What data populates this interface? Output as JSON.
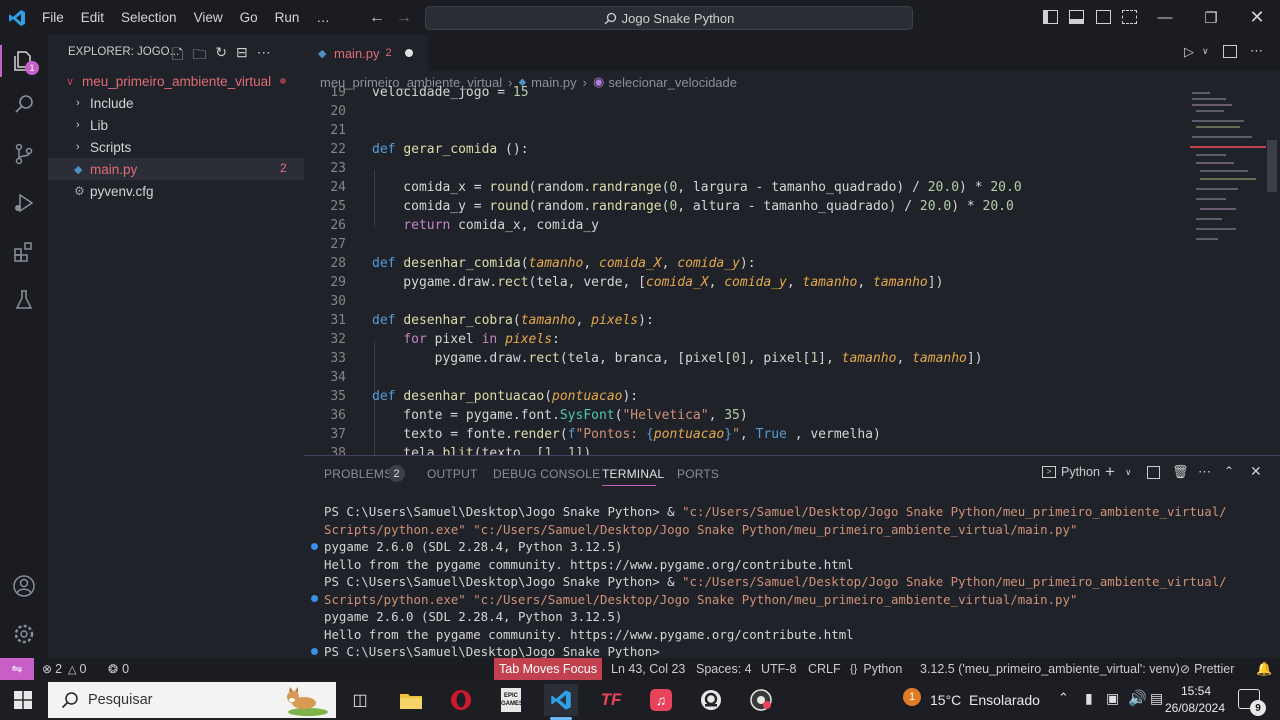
{
  "menu": [
    "File",
    "Edit",
    "Selection",
    "View",
    "Go",
    "Run",
    "…"
  ],
  "search": {
    "text": "Jogo Snake Python"
  },
  "activity": {
    "explorer_badge": "1"
  },
  "explorer": {
    "title": "EXPLORER: JOGO...",
    "root": "meu_primeiro_ambiente_virtual",
    "items": [
      {
        "label": "Include"
      },
      {
        "label": "Lib"
      },
      {
        "label": "Scripts"
      },
      {
        "label": "main.py",
        "badge": "2"
      },
      {
        "label": "pyvenv.cfg"
      }
    ]
  },
  "tab": {
    "label": "main.py",
    "badge": "2"
  },
  "breadcrumb": [
    "meu_primeiro_ambiente_virtual",
    "main.py",
    "selecionar_velocidade"
  ],
  "code_line_numbers": [
    "19",
    "20",
    "21",
    "22",
    "23",
    "24",
    "25",
    "26",
    "27",
    "28",
    "29",
    "30",
    "31",
    "32",
    "33",
    "34",
    "35",
    "36",
    "37",
    "38"
  ],
  "panel": {
    "tabs": [
      "PROBLEMS",
      "OUTPUT",
      "DEBUG CONSOLE",
      "TERMINAL",
      "PORTS"
    ],
    "problems_badge": "2",
    "terminal_type": "Python",
    "lines": [
      {
        "prefix": "PS C:\\Users\\Samuel\\Desktop\\Jogo Snake Python> & ",
        "path": "\"c:/Users/Samuel/Desktop/Jogo Snake Python/meu_primeiro_ambiente_virtual/",
        "dot": false
      },
      {
        "prefix": "",
        "path": "Scripts/python.exe\" \"c:/Users/Samuel/Desktop/Jogo Snake Python/meu_primeiro_ambiente_virtual/main.py\"",
        "dot": false
      },
      {
        "prefix": "pygame 2.6.0 (SDL 2.28.4, Python 3.12.5)",
        "path": "",
        "dot": true
      },
      {
        "prefix": "Hello from the pygame community. https://www.pygame.org/contribute.html",
        "path": "",
        "dot": false
      },
      {
        "prefix": "PS C:\\Users\\Samuel\\Desktop\\Jogo Snake Python> & ",
        "path": "\"c:/Users/Samuel/Desktop/Jogo Snake Python/meu_primeiro_ambiente_virtual/",
        "dot": false
      },
      {
        "prefix": "",
        "path": "Scripts/python.exe\" \"c:/Users/Samuel/Desktop/Jogo Snake Python/meu_primeiro_ambiente_virtual/main.py\"",
        "dot": true
      },
      {
        "prefix": "pygame 2.6.0 (SDL 2.28.4, Python 3.12.5)",
        "path": "",
        "dot": false
      },
      {
        "prefix": "Hello from the pygame community. https://www.pygame.org/contribute.html",
        "path": "",
        "dot": false
      },
      {
        "prefix": "PS C:\\Users\\Samuel\\Desktop\\Jogo Snake Python> ",
        "path": "",
        "dot": true
      }
    ]
  },
  "status": {
    "errors": "2",
    "warnings": "0",
    "ports": "0",
    "tab_focus": "Tab Moves Focus",
    "position": "Ln 43, Col 23",
    "spaces": "Spaces: 4",
    "encoding": "UTF-8",
    "eol": "CRLF",
    "language": "Python",
    "interpreter": "3.12.5 ('meu_primeiro_ambiente_virtual': venv)",
    "prettier": "Prettier"
  },
  "taskbar": {
    "search": "Pesquisar",
    "weather_badge": "1",
    "weather": "15°C  Ensolarado",
    "time": "15:54",
    "date": "26/08/2024",
    "notif_badge": "9"
  },
  "colors": {
    "accent": "#c75fc7",
    "status_focus": "#c2414f",
    "keyword": "#c586c0",
    "function": "#dcdcaa"
  }
}
